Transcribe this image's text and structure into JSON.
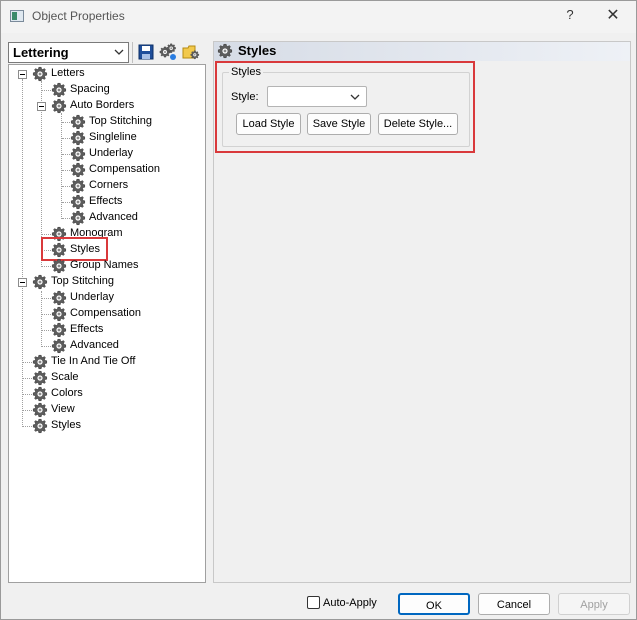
{
  "window": {
    "title": "Object Properties",
    "help": "?",
    "close": "✕"
  },
  "left": {
    "combo_value": "Lettering",
    "tools": [
      "save-icon",
      "gears-icon",
      "folder-gear-icon"
    ]
  },
  "tree": {
    "letters": "Letters",
    "spacing": "Spacing",
    "auto_borders": "Auto Borders",
    "ab_top_stitching": "Top Stitching",
    "ab_singleline": "Singleline",
    "ab_underlay": "Underlay",
    "ab_compensation": "Compensation",
    "ab_corners": "Corners",
    "ab_effects": "Effects",
    "ab_advanced": "Advanced",
    "monogram": "Monogram",
    "styles_child": "Styles",
    "group_names": "Group Names",
    "top_stitching": "Top Stitching",
    "ts_underlay": "Underlay",
    "ts_compensation": "Compensation",
    "ts_effects": "Effects",
    "ts_advanced": "Advanced",
    "tie_in": "Tie In And Tie Off",
    "scale": "Scale",
    "colors": "Colors",
    "view": "View",
    "styles": "Styles"
  },
  "panel": {
    "header": "Styles",
    "group_title": "Styles",
    "style_label": "Style:",
    "style_value": "",
    "load": "Load Style",
    "save": "Save Style",
    "delete": "Delete Style..."
  },
  "footer": {
    "auto_apply": "Auto-Apply",
    "ok": "OK",
    "cancel": "Cancel",
    "apply": "Apply"
  },
  "colors": {
    "highlight": "#d9393b",
    "accent": "#0067c0"
  }
}
